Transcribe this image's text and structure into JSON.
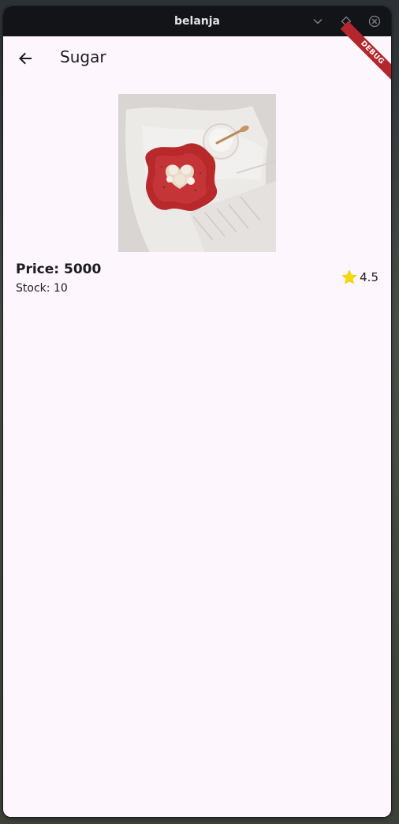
{
  "window": {
    "title": "belanja"
  },
  "appbar": {
    "title": "Sugar",
    "back_icon": "arrow-left-icon",
    "debug_banner": "DEBUG"
  },
  "product": {
    "image_icon": "product-photo",
    "price_text": "Price: 5000",
    "stock_text": "Stock: 10",
    "rating": "4.5",
    "rating_icon": "star-icon",
    "star_color": "#f5d90a"
  },
  "colors": {
    "titlebar": "#121418",
    "background": "#fdf7fd",
    "debug": "#b3262c"
  }
}
